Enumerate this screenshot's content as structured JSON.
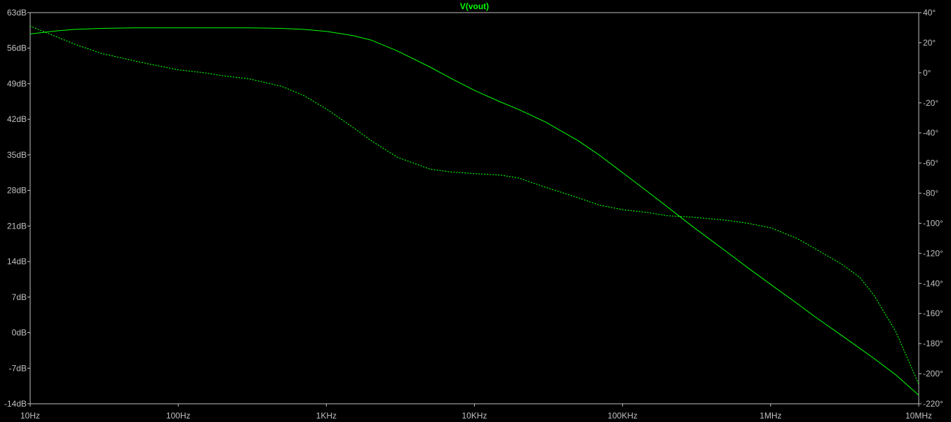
{
  "chart_data": {
    "type": "line",
    "title": "V(vout)",
    "x_scale": "log",
    "xlim": [
      10,
      10000000
    ],
    "x_tick_values": [
      10,
      100,
      1000,
      10000,
      100000,
      1000000,
      10000000
    ],
    "x_tick_labels": [
      "10Hz",
      "100Hz",
      "1KHz",
      "10KHz",
      "100KHz",
      "1MHz",
      "10MHz"
    ],
    "ylim_left": [
      -14,
      63
    ],
    "y_left_tick_values": [
      63,
      56,
      49,
      42,
      35,
      28,
      21,
      14,
      7,
      0,
      -7,
      -14
    ],
    "y_left_tick_labels": [
      "63dB",
      "56dB",
      "49dB",
      "42dB",
      "35dB",
      "28dB",
      "21dB",
      "14dB",
      "7dB",
      "0dB",
      "-7dB",
      "-14dB"
    ],
    "ylim_right": [
      -220,
      40
    ],
    "y_right_tick_values": [
      40,
      20,
      0,
      -20,
      -40,
      -60,
      -80,
      -100,
      -120,
      -140,
      -160,
      -180,
      -200,
      -220
    ],
    "y_right_tick_labels": [
      "40°",
      "20°",
      "0°",
      "-20°",
      "-40°",
      "-60°",
      "-80°",
      "-100°",
      "-120°",
      "-140°",
      "-160°",
      "-180°",
      "-200°",
      "-220°"
    ],
    "grid": false,
    "colors": {
      "background": "#000000",
      "frame": "#c0c0c0",
      "trace": "#00ff00",
      "tick_text": "#c0c0c0",
      "title": "#00ff00"
    },
    "series": [
      {
        "axis": "left",
        "style": "solid",
        "x": [
          10,
          15,
          20,
          30,
          50,
          100,
          200,
          300,
          500,
          700,
          1000,
          1500,
          2000,
          3000,
          5000,
          7000,
          10000,
          15000,
          20000,
          30000,
          50000,
          70000,
          100000,
          150000,
          200000,
          300000,
          500000,
          700000,
          1000000,
          1500000,
          2000000,
          3000000,
          5000000,
          7000000,
          10000000
        ],
        "y": [
          58.8,
          59.4,
          59.7,
          59.9,
          60.0,
          60.0,
          60.0,
          60.0,
          59.9,
          59.7,
          59.3,
          58.5,
          57.6,
          55.5,
          52.3,
          50.0,
          47.7,
          45.4,
          43.9,
          41.5,
          37.8,
          34.9,
          31.5,
          27.6,
          24.8,
          20.8,
          16.0,
          12.8,
          9.5,
          5.8,
          3.1,
          -0.5,
          -5.1,
          -8.3,
          -12.3
        ]
      },
      {
        "axis": "right",
        "style": "dotted",
        "x": [
          10,
          15,
          20,
          30,
          50,
          70,
          100,
          150,
          200,
          300,
          500,
          700,
          1000,
          1500,
          2000,
          3000,
          5000,
          7000,
          10000,
          15000,
          20000,
          30000,
          50000,
          70000,
          100000,
          150000,
          200000,
          300000,
          500000,
          700000,
          1000000,
          1500000,
          2000000,
          3000000,
          4000000,
          5000000,
          7000000,
          10000000
        ],
        "y": [
          31,
          24,
          19,
          13,
          8,
          5,
          2,
          0,
          -2,
          -4,
          -9,
          -15,
          -24,
          -36,
          -45,
          -56,
          -64,
          -66,
          -67,
          -68,
          -70,
          -76,
          -83,
          -88,
          -91,
          -93,
          -95,
          -96,
          -98,
          -100,
          -103,
          -110,
          -117,
          -127,
          -136,
          -148,
          -172,
          -207
        ]
      }
    ]
  }
}
